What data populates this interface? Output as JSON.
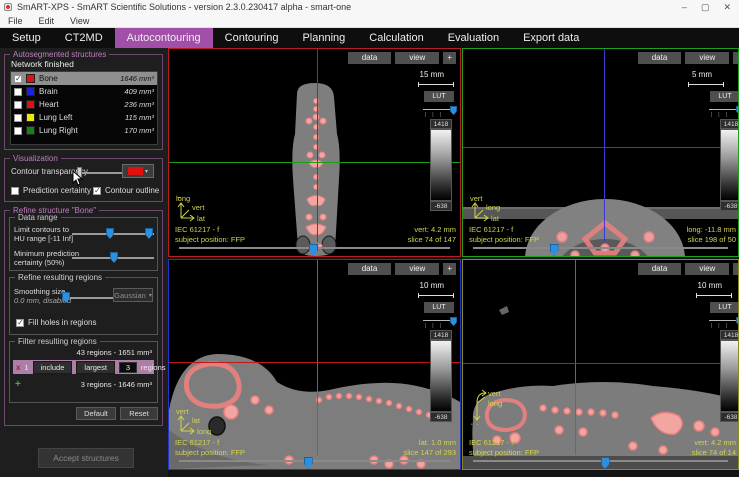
{
  "window": {
    "title": "SmART-XPS - SmART Scientific Solutions - version 2.3.0.230417 alpha - smart-one",
    "minimize": "–",
    "maximize": "▢",
    "close": "✕"
  },
  "menu": {
    "file": "File",
    "edit": "Edit",
    "view": "View"
  },
  "tabs": {
    "active": "Autocontouring",
    "items": [
      "Setup",
      "CT2MD",
      "Autocontouring",
      "Contouring",
      "Planning",
      "Calculation",
      "Evaluation",
      "Export data"
    ]
  },
  "colors": {
    "tab_active": "#a14fa8",
    "group_border": "#6e4a6e",
    "viewport_borders": [
      "#b81e1e",
      "#1ea01e",
      "#2336c8",
      "#8a8a20"
    ],
    "accent_blue_thumb": "#2f8fdf",
    "filter_row_bg": "#ab7fa7",
    "overlay_yellow": "#d4d44c",
    "contour_pink": "#f0948f"
  },
  "structures": {
    "group_title": "Autosegmented structures",
    "status": "Network finished",
    "items": [
      {
        "name": "Bone",
        "volume": "1646 mm³",
        "color": "#e01010",
        "checked": true,
        "selected": true
      },
      {
        "name": "Brain",
        "volume": "409 mm³",
        "color": "#2020e0",
        "checked": false,
        "selected": false
      },
      {
        "name": "Heart",
        "volume": "236 mm³",
        "color": "#e01010",
        "checked": false,
        "selected": false
      },
      {
        "name": "Lung Left",
        "volume": "115 mm³",
        "color": "#e8e810",
        "checked": false,
        "selected": false
      },
      {
        "name": "Lung Right",
        "volume": "170 mm³",
        "color": "#188018",
        "checked": false,
        "selected": false
      }
    ]
  },
  "visualization": {
    "group_title": "Visualization",
    "transparency_label": "Contour transparency",
    "contour_color": "#e01010",
    "prediction_certainty_label": "Prediction certainty",
    "prediction_certainty_checked": false,
    "contour_outline_label": "Contour outline",
    "contour_outline_checked": true
  },
  "refine": {
    "group_title": "Refine structure \"Bone\"",
    "data_range": {
      "group_title": "Data range",
      "hu_label_1": "Limit contours to",
      "hu_label_2": "HU range [-11 Inf]",
      "certainty_label_1": "Minimum prediction",
      "certainty_label_2": "certainty (50%)"
    },
    "refine_regions": {
      "group_title": "Refine resulting regions",
      "smoothing_label_1": "Smoothing size",
      "smoothing_label_2": "0.0 mm, disabled",
      "smoothing_mode": "Gaussian",
      "fill_holes_label": "Fill holes in regions",
      "fill_holes_checked": true
    },
    "filter_regions": {
      "group_title": "Filter resulting regions",
      "total_info": "43 regions - 1651 mm³",
      "rule": {
        "delete": "x",
        "index": "1",
        "mode": "include",
        "criterion": "largest",
        "count": "3",
        "unit": "regions"
      },
      "add_rule": "+",
      "result_info": "3 regions - 1646 mm³"
    },
    "default_button": "Default",
    "reset_button": "Reset"
  },
  "accept_button": "Accept structures",
  "viewports": [
    {
      "name": "coronal-top-left",
      "data_button": "data",
      "view_button": "view",
      "plus_button": "+",
      "scale": "15 mm",
      "lut_button": "LUT",
      "lut_max": "1418",
      "lut_min": "-638",
      "axis_up": "long",
      "axis_mid": "vert",
      "axis_right": "lat",
      "iec": "IEC 61217 - f",
      "subject_position": "subject position: FFP",
      "position": "vert: 4.2 mm",
      "slice": "slice 74 of 147"
    },
    {
      "name": "axial-top-right",
      "data_button": "data",
      "view_button": "view",
      "plus_button": "+",
      "scale": "5 mm",
      "lut_button": "LUT",
      "lut_max": "1418",
      "lut_min": "-638",
      "axis_up": "vert",
      "axis_mid": "long",
      "axis_right": "lat",
      "iec": "IEC 61217 - f",
      "subject_position": "subject position: FFP",
      "position": "long: -11.8 mm",
      "slice": "slice 198 of 50"
    },
    {
      "name": "sagittal-bottom-left",
      "data_button": "data",
      "view_button": "view",
      "plus_button": "+",
      "scale": "10 mm",
      "lut_button": "LUT",
      "lut_max": "1418",
      "lut_min": "-638",
      "axis_up": "vert",
      "axis_mid": "lat",
      "axis_right": "long",
      "iec": "IEC 61217 - f",
      "subject_position": "subject position: FFP",
      "position": "lat: 1.0 mm",
      "slice": "slice 147 of 293"
    },
    {
      "name": "coronal-bottom-right",
      "data_button": "data",
      "view_button": "view",
      "plus_button": "+",
      "scale": "10 mm",
      "lut_button": "LUT",
      "lut_max": "1418",
      "lut_min": "-638",
      "axis_up": "vert",
      "axis_mid": "long",
      "axis_right": "lat",
      "iec": "IEC 61217 - f",
      "subject_position": "subject position: FFP",
      "position": "vert: 4.2 mm",
      "slice": "slice 74 of 14"
    }
  ]
}
